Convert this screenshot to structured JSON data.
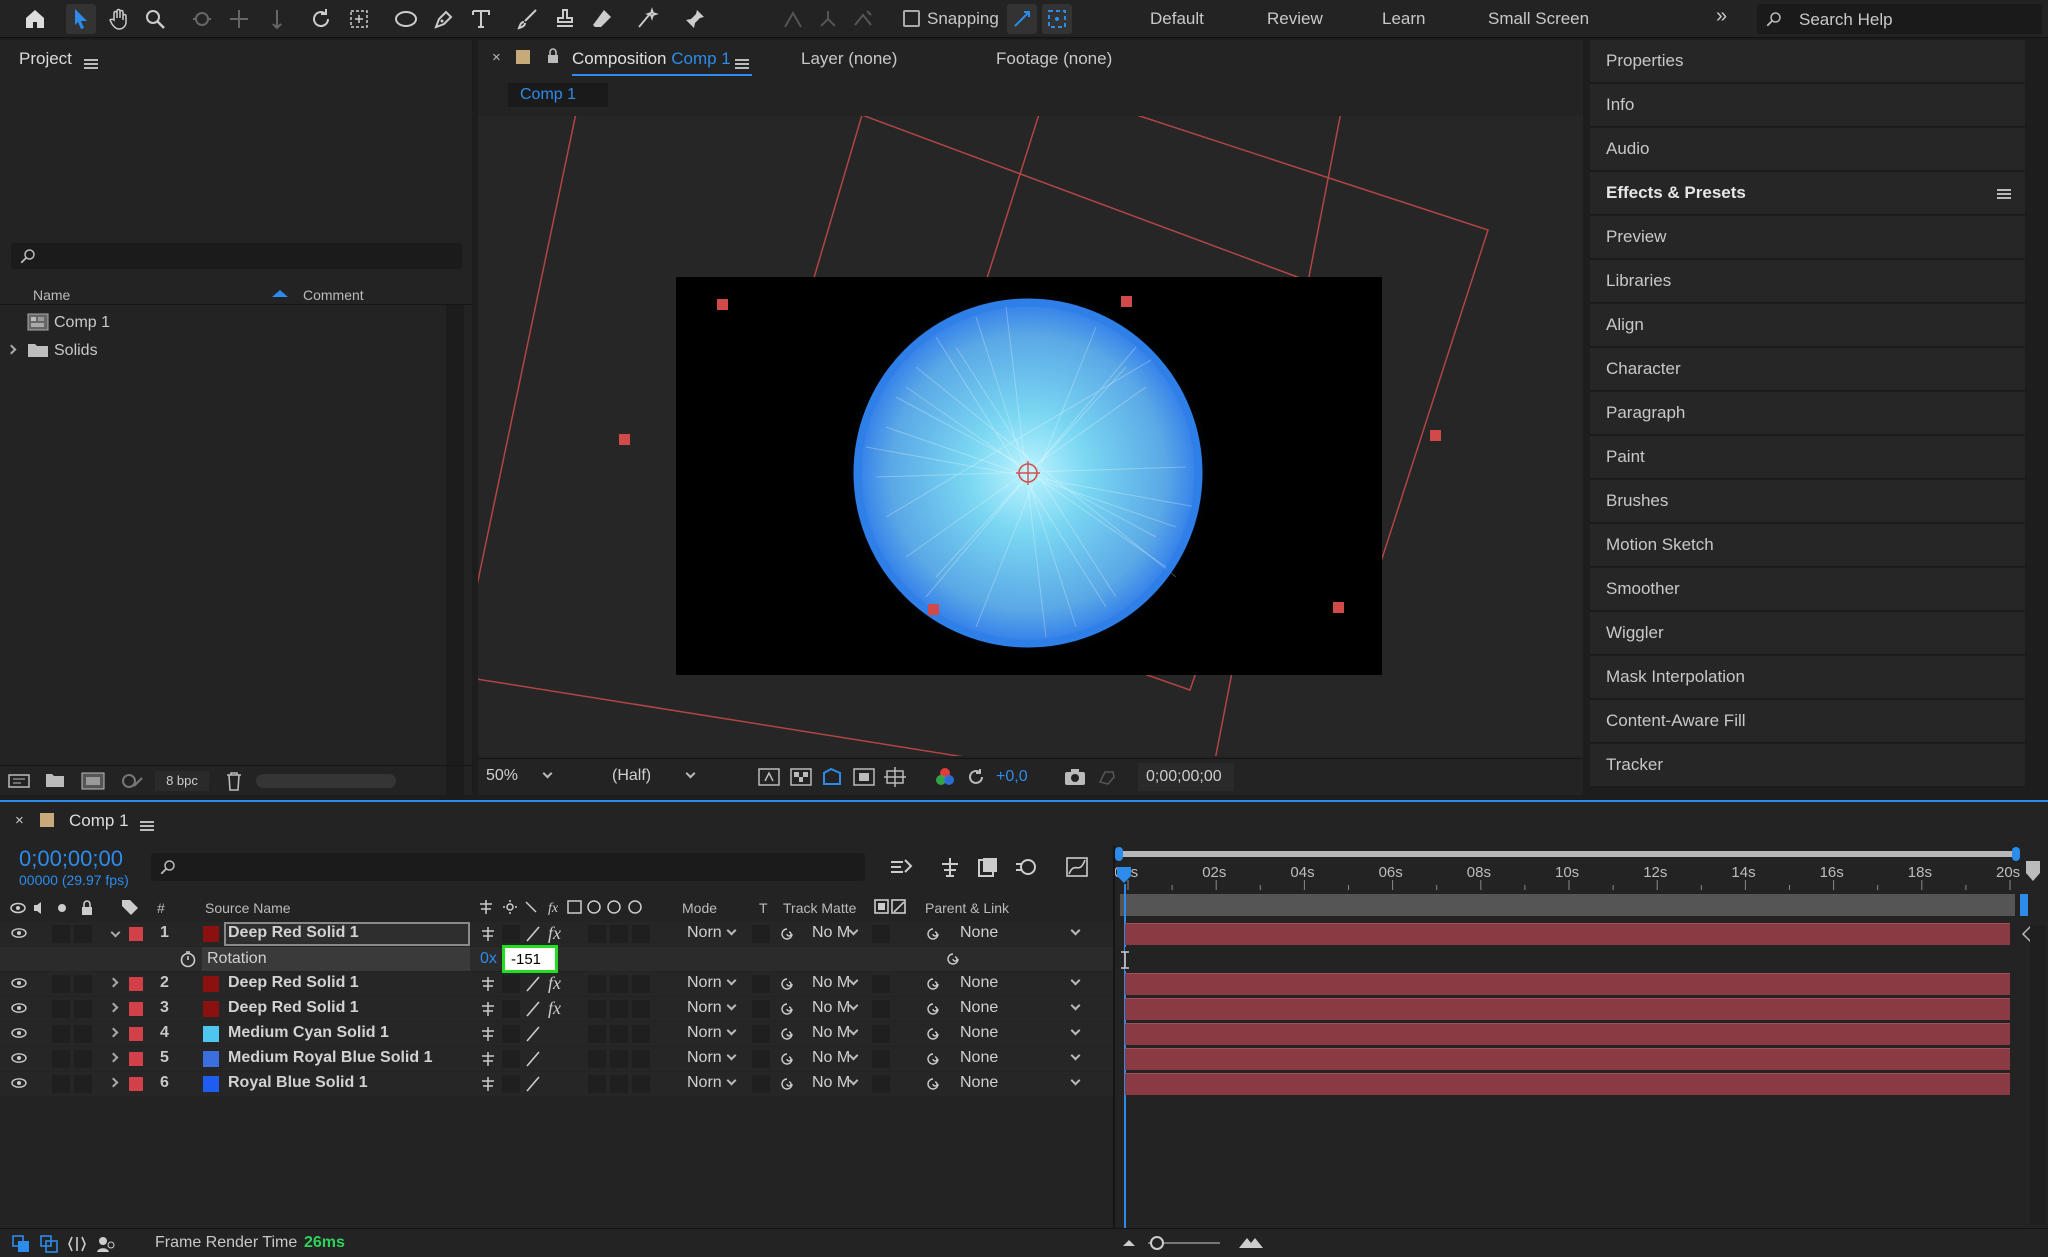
{
  "toolbar": {
    "snapping_label": "Snapping",
    "workspaces": [
      "Default",
      "Review",
      "Learn",
      "Small Screen"
    ],
    "more": "»",
    "search_placeholder": "Search Help"
  },
  "project": {
    "title": "Project",
    "col_name": "Name",
    "col_comment": "Comment",
    "items": [
      {
        "label": "Comp 1",
        "icon": "composition-icon"
      },
      {
        "label": "Solids",
        "icon": "folder-icon"
      }
    ],
    "bpc": "8 bpc"
  },
  "viewer": {
    "tab_prefix": "Composition",
    "tab_comp": "Comp 1",
    "layer_tab": "Layer (none)",
    "footage_tab": "Footage (none)",
    "breadcrumb": "Comp 1",
    "zoom": "50%",
    "resolution": "(Half)",
    "exposure": "+0,0",
    "timecode": "0;00;00;00"
  },
  "right_panels": [
    {
      "label": "Properties",
      "bold": false
    },
    {
      "label": "Info",
      "bold": false
    },
    {
      "label": "Audio",
      "bold": false
    },
    {
      "label": "Effects & Presets",
      "bold": true
    },
    {
      "label": "Preview",
      "bold": false
    },
    {
      "label": "Libraries",
      "bold": false
    },
    {
      "label": "Align",
      "bold": false
    },
    {
      "label": "Character",
      "bold": false
    },
    {
      "label": "Paragraph",
      "bold": false
    },
    {
      "label": "Paint",
      "bold": false
    },
    {
      "label": "Brushes",
      "bold": false
    },
    {
      "label": "Motion Sketch",
      "bold": false
    },
    {
      "label": "Smoother",
      "bold": false
    },
    {
      "label": "Wiggler",
      "bold": false
    },
    {
      "label": "Mask Interpolation",
      "bold": false
    },
    {
      "label": "Content-Aware Fill",
      "bold": false
    },
    {
      "label": "Tracker",
      "bold": false
    }
  ],
  "timeline": {
    "tab": "Comp 1",
    "timecode": "0;00;00;00",
    "fps": "00000 (29.97 fps)",
    "col_source": "Source Name",
    "col_mode": "Mode",
    "col_t": "T",
    "col_track": "Track Matte",
    "col_parent": "Parent & Link",
    "col_num": "#",
    "ticks": [
      "00s",
      "02s",
      "04s",
      "06s",
      "08s",
      "10s",
      "12s",
      "14s",
      "16s",
      "18s",
      "20s"
    ],
    "rotation_label": "Rotation",
    "rotation_turns": "0x",
    "rotation_value": "-151",
    "layers": [
      {
        "num": "1",
        "name": "Deep Red Solid 1",
        "color": "#8b1010",
        "fx": true,
        "mode": "Norn",
        "matte": "No M",
        "parent": "None"
      },
      {
        "num": "2",
        "name": "Deep Red Solid 1",
        "color": "#8b1010",
        "fx": true,
        "mode": "Norn",
        "matte": "No M",
        "parent": "None"
      },
      {
        "num": "3",
        "name": "Deep Red Solid 1",
        "color": "#8b1010",
        "fx": true,
        "mode": "Norn",
        "matte": "No M",
        "parent": "None"
      },
      {
        "num": "4",
        "name": "Medium Cyan Solid 1",
        "color": "#4fc6ef",
        "fx": false,
        "mode": "Norn",
        "matte": "No M",
        "parent": "None"
      },
      {
        "num": "5",
        "name": "Medium Royal Blue Solid 1",
        "color": "#3b6fe0",
        "fx": false,
        "mode": "Norn",
        "matte": "No M",
        "parent": "None"
      },
      {
        "num": "6",
        "name": "Royal Blue Solid 1",
        "color": "#1f5cf0",
        "fx": false,
        "mode": "Norn",
        "matte": "No M",
        "parent": "None"
      }
    ],
    "fx_label": "fx",
    "render_label": "Frame Render Time",
    "render_value": "26ms"
  },
  "colors": {
    "accent": "#2d8ceb",
    "label_red": "#d2404a",
    "track": "#8a3a43",
    "highlight": "#22dd22"
  }
}
